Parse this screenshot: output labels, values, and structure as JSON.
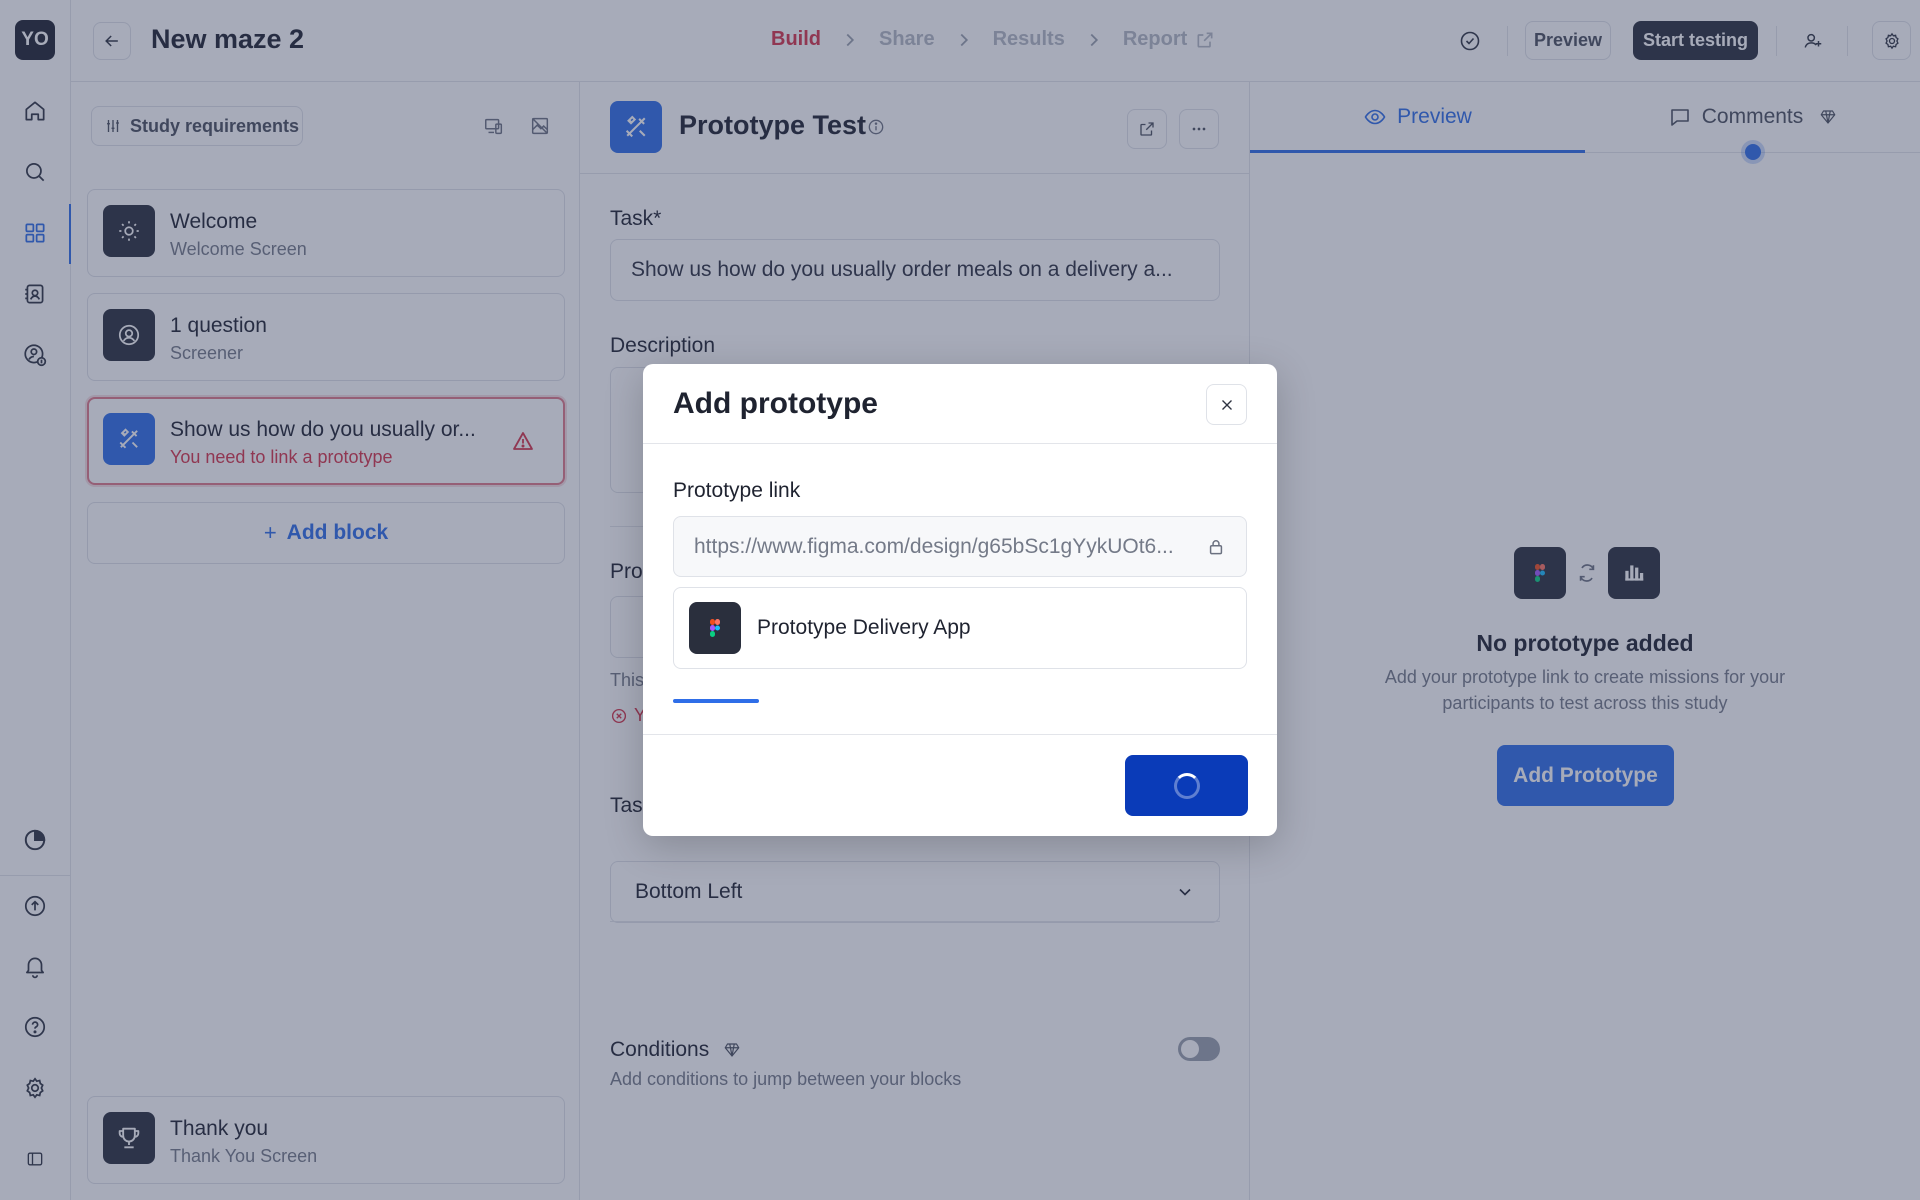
{
  "app": {
    "avatar_initials": "YO",
    "colors": {
      "accent": "#2f6ee8",
      "error": "#d6334a",
      "dark": "#2a2f3d"
    }
  },
  "rail": {
    "icons": [
      "home-icon",
      "search-icon",
      "grid-icon",
      "contacts-icon",
      "user-dollar-icon",
      "pie-chart-icon",
      "upload-icon",
      "bell-icon",
      "help-icon",
      "gear-icon",
      "sidebar-toggle-icon"
    ],
    "active_item": "grid-icon"
  },
  "header": {
    "title": "New maze 2",
    "steps": [
      {
        "label": "Build",
        "active": true
      },
      {
        "label": "Share",
        "active": false
      },
      {
        "label": "Results",
        "active": false
      },
      {
        "label": "Report",
        "active": false
      }
    ],
    "preview_label": "Preview",
    "start_label": "Start testing"
  },
  "sidebar": {
    "requirements_label": "Study requirements",
    "blocks": [
      {
        "title": "Welcome",
        "subtitle": "Welcome Screen",
        "icon": "sun-icon",
        "error": false
      },
      {
        "title": "1 question",
        "subtitle": "Screener",
        "icon": "user-circle-icon",
        "error": false
      },
      {
        "title": "Show us how do you usually or...",
        "subtitle": "You need to link a prototype",
        "icon": "tools-icon",
        "error": true
      }
    ],
    "add_block_label": "Add block",
    "footer_block": {
      "title": "Thank you",
      "subtitle": "Thank You Screen",
      "icon": "trophy-icon"
    }
  },
  "editor": {
    "title": "Prototype Test",
    "task_label": "Task*",
    "task_value": "Show us how do you usually order meals on a delivery a...",
    "description_label": "Description",
    "prototype_label_partial": "Pro",
    "helper_partial": "This",
    "error_partial": "Y",
    "task_position_label_partial": "Tas",
    "task_position_value": "Bottom Left",
    "conditions_label": "Conditions",
    "conditions_sub": "Add conditions to jump between your blocks",
    "conditions_enabled": false
  },
  "preview_panel": {
    "tabs": [
      {
        "label": "Preview",
        "icon": "eye-icon",
        "active": true
      },
      {
        "label": "Comments",
        "icon": "comment-icon",
        "active": false
      }
    ],
    "empty_title": "No prototype added",
    "empty_desc": "Add your prototype link to create missions for your participants to test across this study",
    "add_button_label": "Add Prototype"
  },
  "modal": {
    "title": "Add prototype",
    "link_label": "Prototype link",
    "link_value": "https://www.figma.com/design/g65bSc1gYykUOt6...",
    "prototype_name": "Prototype Delivery App",
    "progress": 0.15,
    "confirm_loading": true
  }
}
